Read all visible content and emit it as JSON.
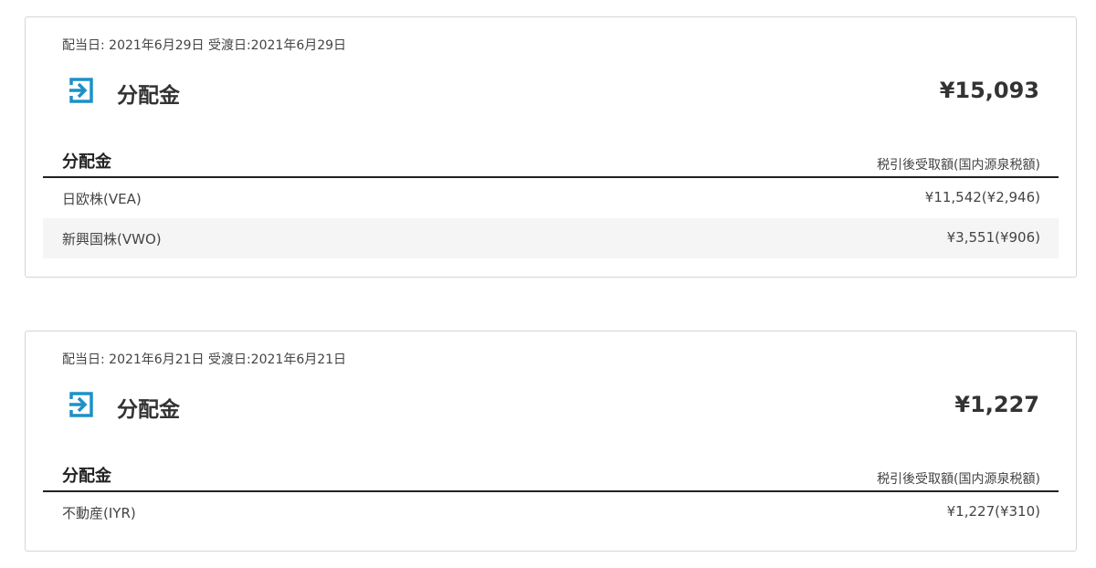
{
  "colors": {
    "icon": "#1e90c8",
    "row_alt": "#f5f5f5",
    "border": "#d5d5d5",
    "header_rule": "#222222"
  },
  "cards": [
    {
      "dates": "配当日: 2021年6月29日 受渡日:2021年6月29日",
      "icon": "arrow-into-box-icon",
      "title": "分配金",
      "amount": "¥15,093",
      "table_header_left": "分配金",
      "table_header_right": "税引後受取額(国内源泉税額)",
      "rows": [
        {
          "name": "日欧株(VEA)",
          "value": "¥11,542(¥2,946)"
        },
        {
          "name": "新興国株(VWO)",
          "value": "¥3,551(¥906)"
        }
      ]
    },
    {
      "dates": "配当日: 2021年6月21日 受渡日:2021年6月21日",
      "icon": "arrow-into-box-icon",
      "title": "分配金",
      "amount": "¥1,227",
      "table_header_left": "分配金",
      "table_header_right": "税引後受取額(国内源泉税額)",
      "rows": [
        {
          "name": "不動産(IYR)",
          "value": "¥1,227(¥310)"
        }
      ]
    }
  ]
}
